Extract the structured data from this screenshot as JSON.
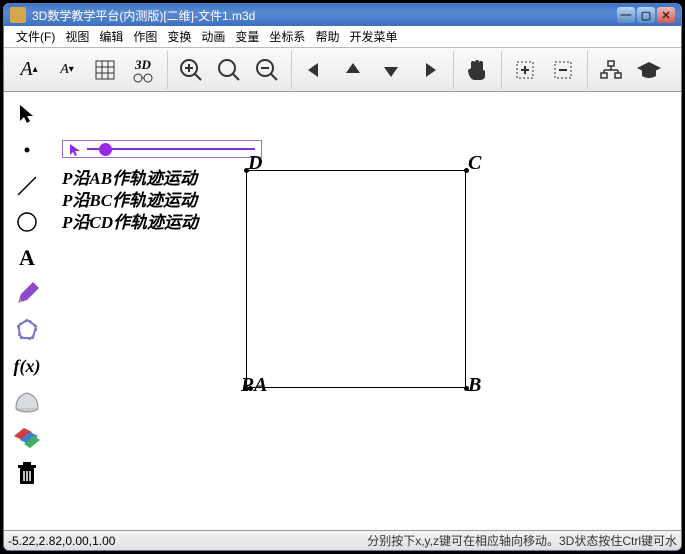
{
  "title": "3D数学教学平台(内测版)[二维]-文件1.m3d",
  "menu": {
    "file": "文件(F)",
    "view": "视图",
    "edit": "编辑",
    "draw": "作图",
    "transform": "变换",
    "animate": "动画",
    "variable": "变量",
    "coord": "坐标系",
    "help": "帮助",
    "dev": "开发菜单"
  },
  "texts": {
    "l1": "P沿AB作轨迹运动",
    "l2": "P沿BC作轨迹运动",
    "l3": "P沿CD作轨迹运动"
  },
  "labels": {
    "A": "A",
    "B": "B",
    "C": "C",
    "D": "D",
    "PH": "P"
  },
  "status": {
    "coords": "-5.22,2.82,0.00,1.00",
    "hint": "分别按下x,y,z键可在相应轴向移动。3D状态按住Ctrl键可水"
  },
  "chart_data": {
    "type": "diagram",
    "shape": "square",
    "vertices": [
      {
        "name": "A",
        "approx_x": -0.1,
        "approx_y": -0.1,
        "corner": "bottom-left"
      },
      {
        "name": "B",
        "approx_x": 4.2,
        "approx_y": -0.1,
        "corner": "bottom-right"
      },
      {
        "name": "C",
        "approx_x": 4.2,
        "approx_y": 4.2,
        "corner": "top-right"
      },
      {
        "name": "D",
        "approx_x": -0.1,
        "approx_y": 4.2,
        "corner": "top-left"
      }
    ],
    "moving_point": "P",
    "P_at": "A",
    "slider_value": 0.05,
    "slider_range": [
      0,
      1
    ]
  }
}
